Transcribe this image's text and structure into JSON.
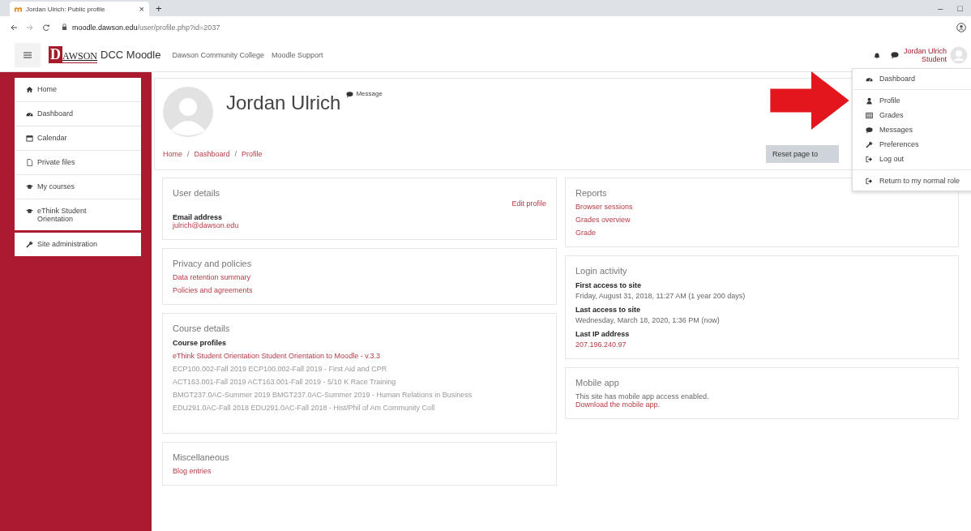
{
  "browser": {
    "tab_title": "Jordan Ulrich: Public profile",
    "tab_close": "×",
    "new_tab": "+",
    "url_host": "moodle.dawson.edu",
    "url_path": "/user/profile.php?id=2037",
    "window_controls": [
      "–",
      "□"
    ]
  },
  "navbar": {
    "logo_initial": "D",
    "logo_rest": "AWSON",
    "site_name": "DCC Moodle",
    "links": [
      "Dawson Community College",
      "Moodle Support"
    ],
    "user_name": "Jordan Ulrich",
    "user_role": "Student"
  },
  "sidebar": {
    "items": [
      "Home",
      "Dashboard",
      "Calendar",
      "Private files",
      "My courses",
      "eThink Student Orientation"
    ],
    "admin": "Site administration"
  },
  "header": {
    "name": "Jordan Ulrich",
    "message": "Message",
    "breadcrumb": [
      "Home",
      "Dashboard",
      "Profile"
    ],
    "separator": "/",
    "reset_button": "Reset page to"
  },
  "user_details": {
    "title": "User details",
    "edit": "Edit profile",
    "fields": [
      {
        "label": "Email address",
        "value": "julrich@dawson.edu"
      }
    ]
  },
  "privacy": {
    "title": "Privacy and policies",
    "links": [
      "Data retention summary",
      "Policies and agreements"
    ]
  },
  "course_details": {
    "title": "Course details",
    "subtitle": "Course profiles",
    "courses": [
      {
        "name": "eThink Student Orientation Student Orientation to Moodle - v.3.3",
        "dimmed": false
      },
      {
        "name": "ECP100.002-Fall 2019 ECP100.002-Fall 2019 - First Aid and CPR",
        "dimmed": true
      },
      {
        "name": "ACT163.001-Fall 2019 ACT163.001-Fall 2019 - 5/10 K Race Training",
        "dimmed": true
      },
      {
        "name": "BMGT237.0AC-Summer 2019 BMGT237.0AC-Summer 2019 - Human Relations in Business",
        "dimmed": true
      },
      {
        "name": "EDU291.0AC-Fall 2018 EDU291.0AC-Fall 2018 - Hist/Phil of Am Community Coll",
        "dimmed": true
      }
    ]
  },
  "miscellaneous": {
    "title": "Miscellaneous",
    "links": [
      "Blog entries"
    ]
  },
  "reports": {
    "title": "Reports",
    "links": [
      "Browser sessions",
      "Grades overview",
      "Grade"
    ]
  },
  "login_activity": {
    "title": "Login activity",
    "fields": [
      {
        "label": "First access to site",
        "value": "Friday, August 31, 2018, 11:27 AM  (1 year 200 days)",
        "link": false
      },
      {
        "label": "Last access to site",
        "value": "Wednesday, March 18, 2020, 1:36 PM  (now)",
        "link": false
      },
      {
        "label": "Last IP address",
        "value": "207.196.240.97",
        "link": true
      }
    ]
  },
  "mobile_app": {
    "title": "Mobile app",
    "text": "This site has mobile app access enabled.",
    "link": "Download the mobile app."
  },
  "user_menu": {
    "groups": [
      [
        "Dashboard"
      ],
      [
        "Profile",
        "Grades",
        "Messages",
        "Preferences",
        "Log out"
      ],
      [
        "Return to my normal role"
      ]
    ]
  }
}
